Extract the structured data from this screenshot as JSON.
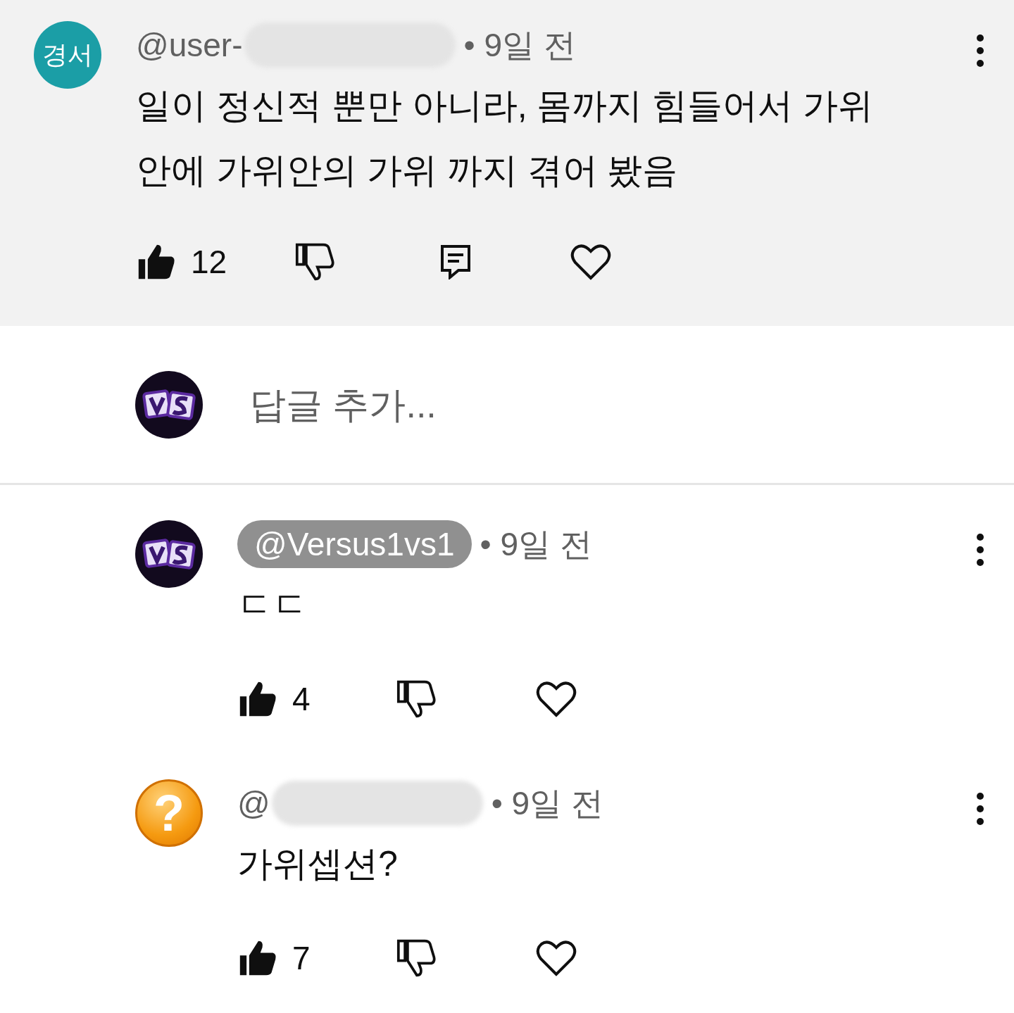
{
  "comment": {
    "avatar": {
      "kind": "initials",
      "text": "경서",
      "color": "#1b9ea6"
    },
    "author": "@user-",
    "redacted": true,
    "highlighted": false,
    "time": "• 9일 전",
    "text": "일이 정신적 뿐만 아니라, 몸까지 힘들어서 가위안에 가위안의 가위 까지 겪어 봤음",
    "liked": true,
    "likes": "12"
  },
  "reply_box": {
    "avatar": {
      "kind": "vs"
    },
    "placeholder": "답글 추가..."
  },
  "replies": [
    {
      "avatar": {
        "kind": "vs"
      },
      "author": "@Versus1vs1",
      "redacted": false,
      "highlighted": true,
      "time": "• 9일 전",
      "text": "ㄷㄷ",
      "liked": true,
      "likes": "4"
    },
    {
      "avatar": {
        "kind": "glyph",
        "text": "?"
      },
      "author": "@",
      "redacted": true,
      "highlighted": false,
      "time": "• 9일 전",
      "text": "가위셉션?",
      "liked": true,
      "likes": "7"
    }
  ]
}
